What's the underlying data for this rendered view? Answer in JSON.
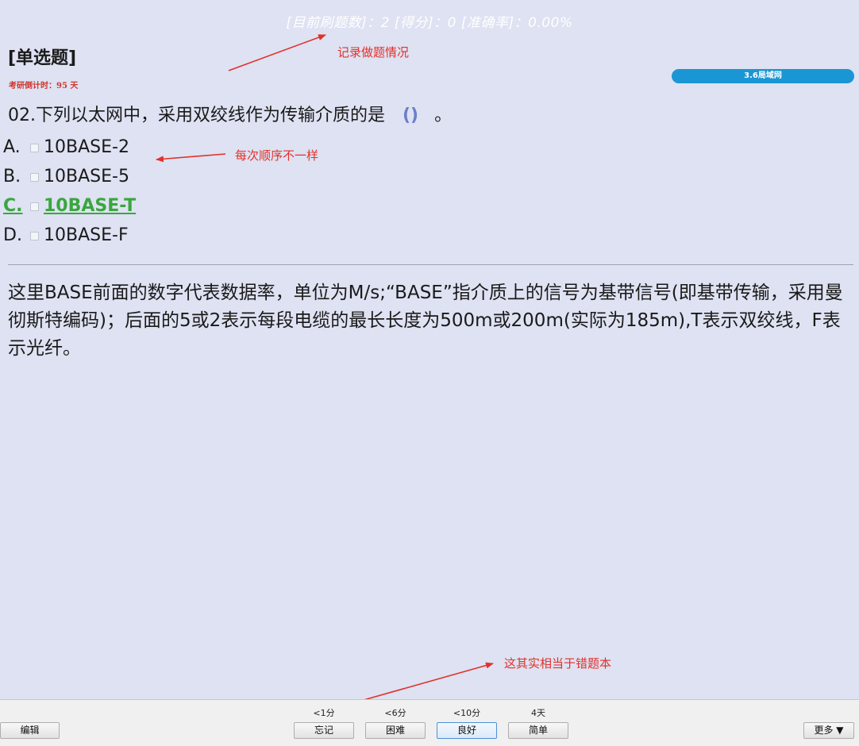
{
  "header": {
    "stats": "[目前刷题数]：2  [得分]：0  [准确率]：0.00%",
    "question_type": "[单选题]",
    "countdown": "考研倒计时：95 天",
    "deck_name": "3.6局域网"
  },
  "question": {
    "text": "02.下列以太网中，采用双绞线作为传输介质的是",
    "paren": "()",
    "end": "。"
  },
  "options": [
    {
      "letter": "A.",
      "text": "10BASE-2",
      "correct": false
    },
    {
      "letter": "B.",
      "text": "10BASE-5",
      "correct": false
    },
    {
      "letter": "C.",
      "text": "10BASE-T",
      "correct": true
    },
    {
      "letter": "D.",
      "text": "10BASE-F",
      "correct": false
    }
  ],
  "explanation": "这里BASE前面的数字代表数据率，单位为M/s;“BASE”指介质上的信号为基带信号(即基带传输，采用曼彻斯特编码)；后面的5或2表示每段电缆的最长长度为500m或200m(实际为185m),T表示双绞线，F表示光纤。",
  "annotations": {
    "record": "记录做题情况",
    "order": "每次顺序不一样",
    "wrongbook": "这其实相当于错题本",
    "color": "#e2312a"
  },
  "bottom_bar": {
    "edit": "编辑",
    "more": "更多 ▼",
    "ease": [
      {
        "time": "<1分",
        "label": "忘记"
      },
      {
        "time": "<6分",
        "label": "困难"
      },
      {
        "time": "<10分",
        "label": "良好"
      },
      {
        "time": "4天",
        "label": "简单"
      }
    ]
  },
  "colors": {
    "background": "#dee2f2",
    "correct": "#3aa63f",
    "badge": "#1b96d5"
  }
}
